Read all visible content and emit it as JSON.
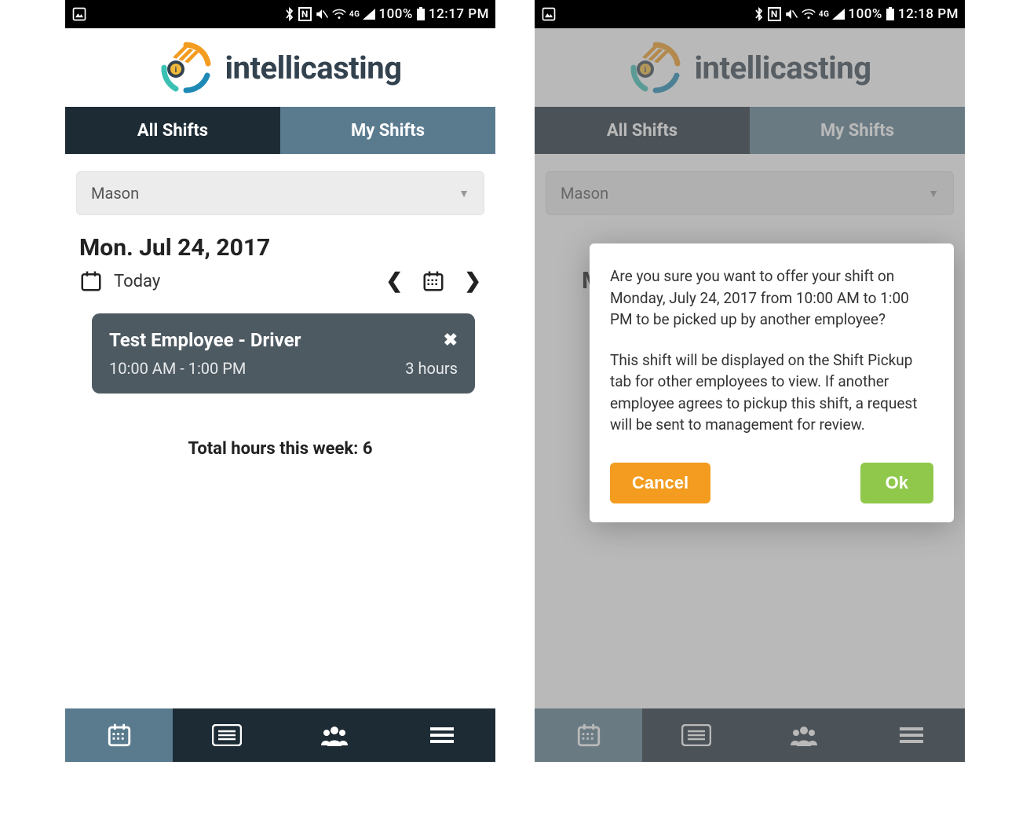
{
  "status": {
    "battery": "100%",
    "time1": "12:17 PM",
    "time2": "12:18 PM",
    "network": "4G"
  },
  "brand": "intellicasting",
  "tabs": {
    "all": "All Shifts",
    "my": "My Shifts"
  },
  "filter": {
    "name": "Mason"
  },
  "date": {
    "heading": "Mon. Jul 24, 2017",
    "today_label": "Today",
    "peek": "M"
  },
  "shift": {
    "title": "Test Employee - Driver",
    "time": "10:00 AM - 1:00 PM",
    "duration": "3 hours"
  },
  "total_label": "Total hours this week: 6",
  "dialog": {
    "p1": "Are you sure you want to offer your shift on Monday, July 24, 2017 from 10:00 AM to 1:00 PM to be picked up by another employee?",
    "p2": "This shift will be displayed on the Shift Pickup tab for other employees to view. If another employee agrees to pickup this shift, a request will be sent to management for review.",
    "cancel": "Cancel",
    "ok": "Ok"
  }
}
